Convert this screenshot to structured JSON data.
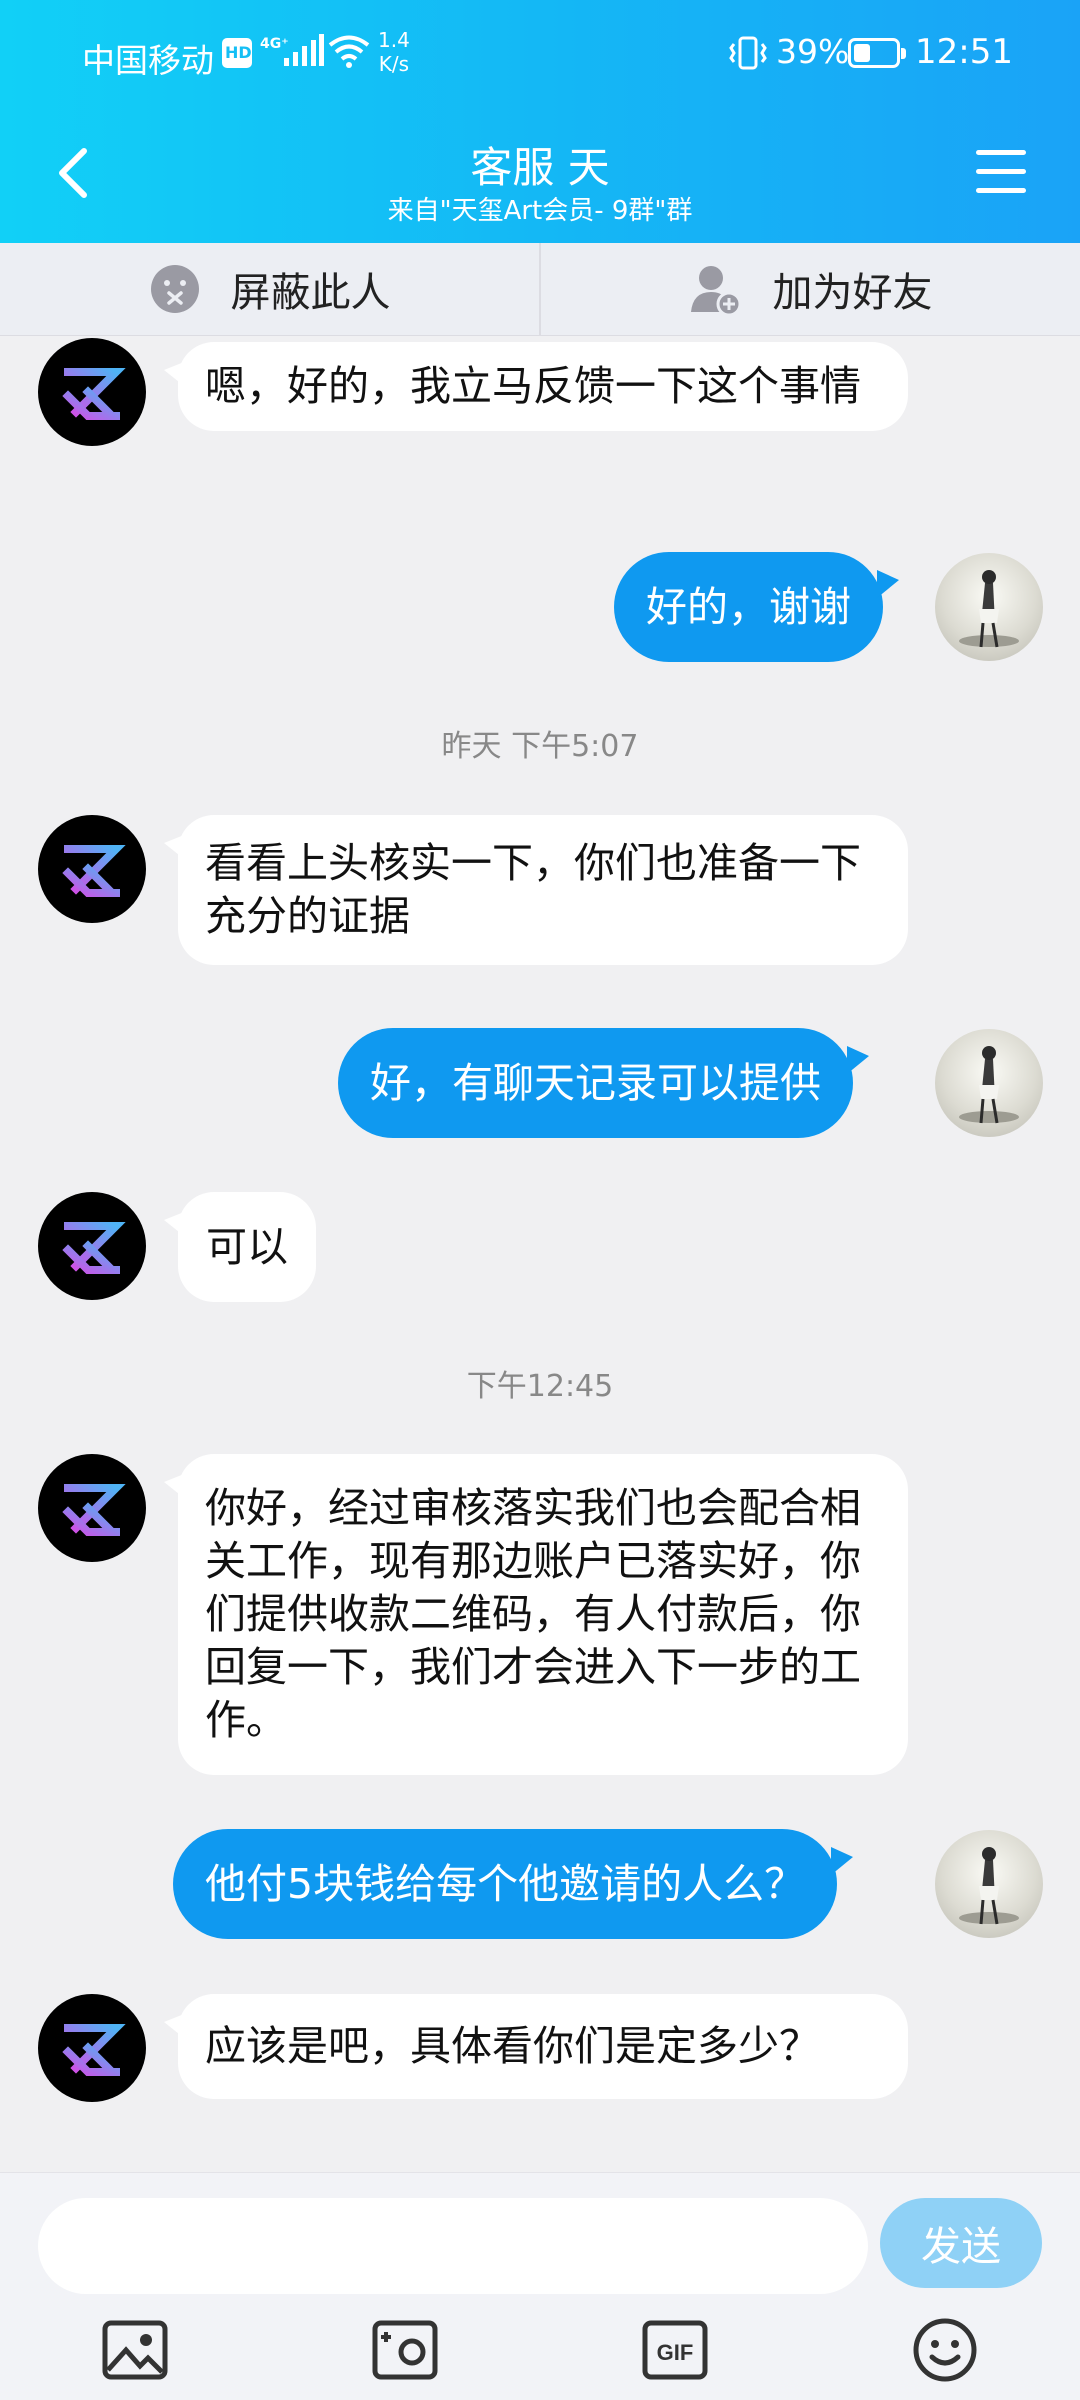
{
  "status": {
    "carrier": "中国移动",
    "hd": "HD",
    "network": "4G⁺",
    "speed_value": "1.4",
    "speed_unit": "K/s",
    "battery": "39%",
    "time": "12:51"
  },
  "header": {
    "title": "客服 天",
    "subtitle": "来自\"天玺Art会员- 9群\"群"
  },
  "actions": {
    "block": "屏蔽此人",
    "add_friend": "加为好友"
  },
  "messages": [
    {
      "side": "left",
      "text": "嗯，好的，我立马反馈一下这个事情"
    },
    {
      "side": "right",
      "text": "好的，谢谢"
    },
    {
      "side": "time",
      "text": "昨天 下午5:07"
    },
    {
      "side": "left",
      "text": "看看上头核实一下，你们也准备一下充分的证据"
    },
    {
      "side": "right",
      "text": "好，有聊天记录可以提供"
    },
    {
      "side": "left",
      "text": "可以"
    },
    {
      "side": "time",
      "text": "下午12:45"
    },
    {
      "side": "left",
      "text": "你好，经过审核落实我们也会配合相关工作，现有那边账户已落实好，你们提供收款二维码，有人付款后，你回复一下，我们才会进入下一步的工作。"
    },
    {
      "side": "right",
      "text": "他付5块钱给每个他邀请的人么？"
    },
    {
      "side": "left",
      "text": "应该是吧，具体看你们是定多少？"
    }
  ],
  "input": {
    "placeholder": "",
    "send_label": "发送"
  },
  "toolbar_icons": [
    "image-icon",
    "camera-icon",
    "gif-icon",
    "emoji-icon"
  ],
  "gif_label": "GIF",
  "colors": {
    "header_start": "#11d0f7",
    "header_end": "#1aa3f7",
    "my_bubble": "#0f99f0",
    "send_button": "#8fd1f6"
  }
}
